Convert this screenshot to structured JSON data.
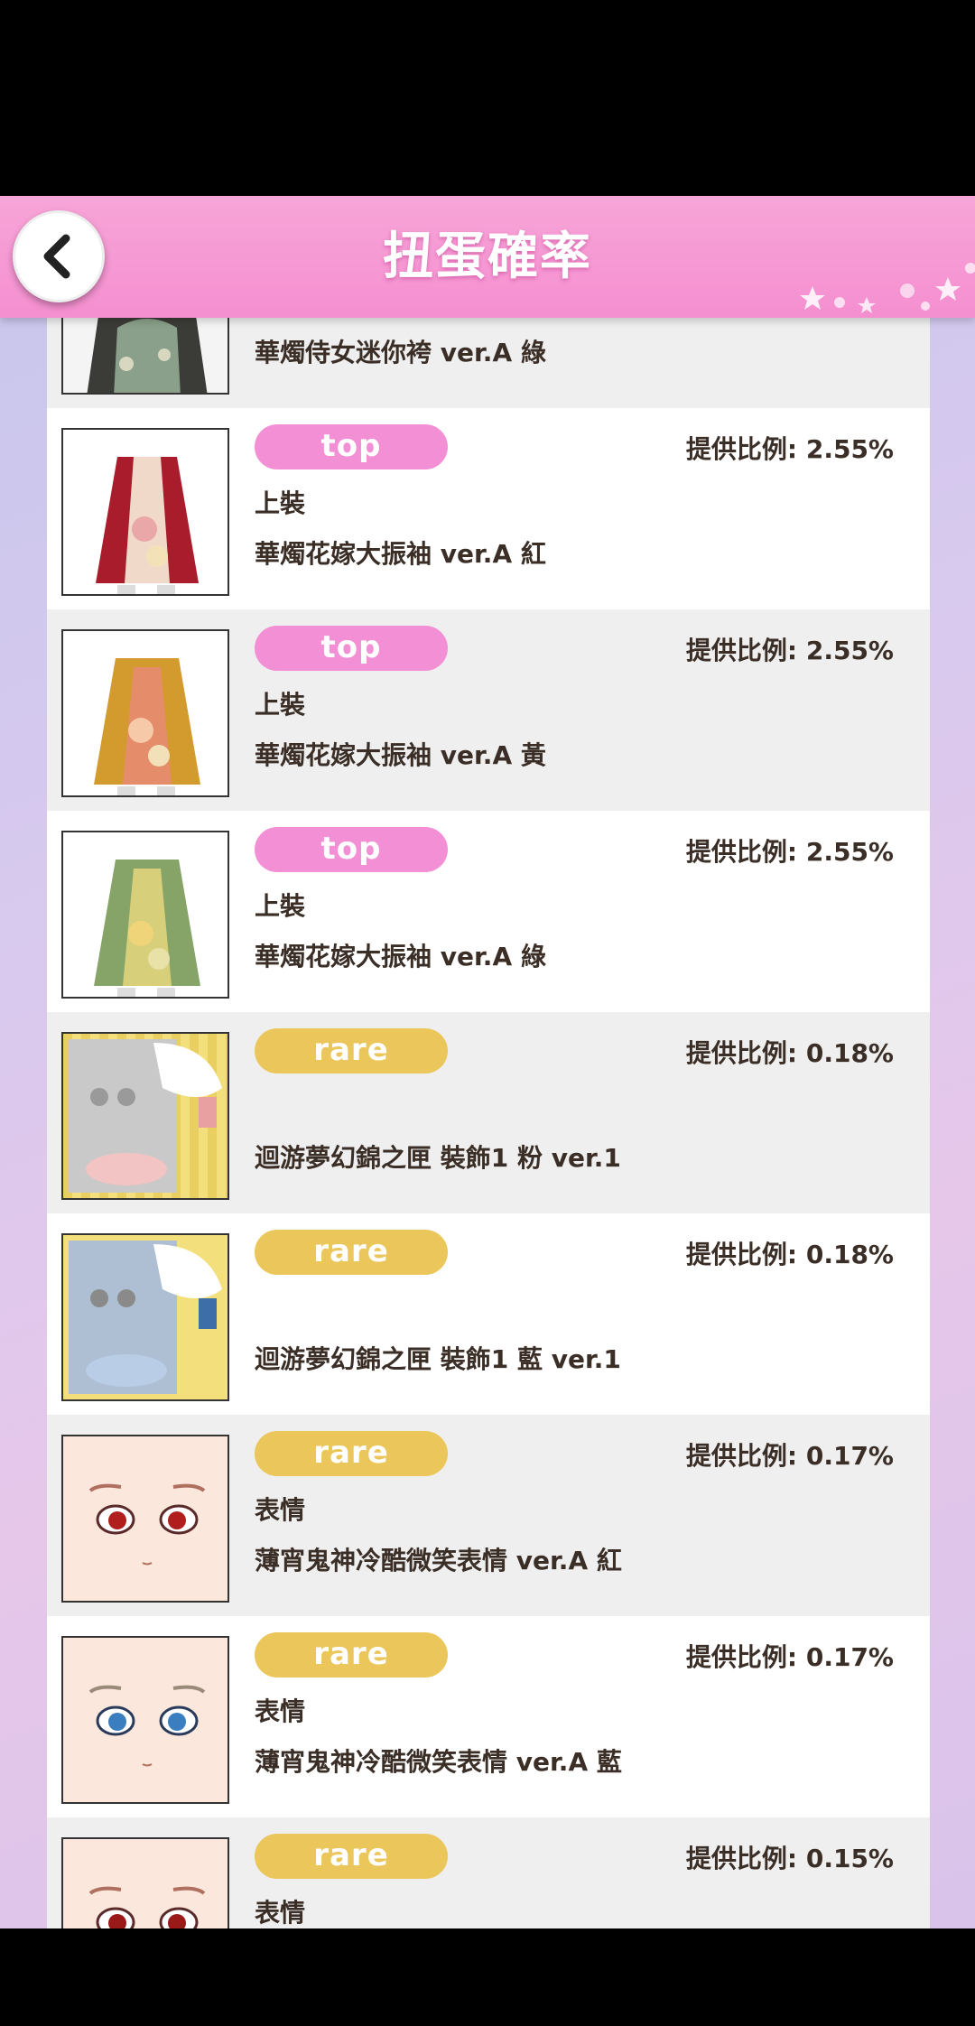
{
  "header": {
    "title": "扭蛋確率"
  },
  "colors": {
    "header_pink": "#f58fd0",
    "badge_top": "#f38fd5",
    "badge_rare": "#ebc65a",
    "text": "#3a2e26"
  },
  "items": [
    {
      "badge": "",
      "rate": "",
      "category": "",
      "name": "華燭侍女迷你袴 ver.A 綠",
      "thumb": "dress-green-partial"
    },
    {
      "badge": "top",
      "rate": "提供比例: 2.55%",
      "category": "上裝",
      "name": "華燭花嫁大振袖 ver.A 紅",
      "thumb": "kimono-red"
    },
    {
      "badge": "top",
      "rate": "提供比例: 2.55%",
      "category": "上裝",
      "name": "華燭花嫁大振袖 ver.A 黃",
      "thumb": "kimono-yellow"
    },
    {
      "badge": "top",
      "rate": "提供比例: 2.55%",
      "category": "上裝",
      "name": "華燭花嫁大振袖 ver.A 綠",
      "thumb": "kimono-green"
    },
    {
      "badge": "rare",
      "rate": "提供比例: 0.18%",
      "category": "",
      "name": "迴游夢幻錦之匣 裝飾1 粉 ver.1",
      "thumb": "decor-pink"
    },
    {
      "badge": "rare",
      "rate": "提供比例: 0.18%",
      "category": "",
      "name": "迴游夢幻錦之匣 裝飾1 藍 ver.1",
      "thumb": "decor-blue"
    },
    {
      "badge": "rare",
      "rate": "提供比例: 0.17%",
      "category": "表情",
      "name": "薄宵鬼神冷酷微笑表情 ver.A 紅",
      "thumb": "face-red"
    },
    {
      "badge": "rare",
      "rate": "提供比例: 0.17%",
      "category": "表情",
      "name": "薄宵鬼神冷酷微笑表情 ver.A 藍",
      "thumb": "face-blue"
    },
    {
      "badge": "rare",
      "rate": "提供比例: 0.15%",
      "category": "表情",
      "name": "",
      "thumb": "face-red-2"
    }
  ]
}
